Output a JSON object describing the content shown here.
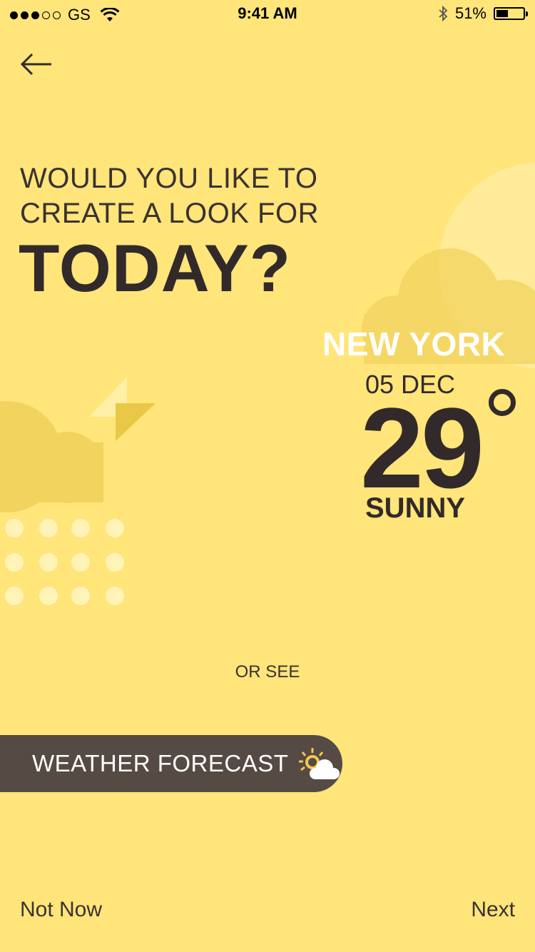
{
  "status_bar": {
    "carrier": "GS",
    "time": "9:41 AM",
    "battery_percent": "51%",
    "battery_level": 0.51,
    "signal_bars_filled": 3,
    "signal_bars_total": 5
  },
  "nav": {
    "back_icon": "arrow-left-icon"
  },
  "question": {
    "line1": "WOULD YOU LIKE TO",
    "line2": "CREATE A LOOK FOR",
    "line3": "TODAY?"
  },
  "weather": {
    "city": "NEW YORK",
    "date": "05 DEC",
    "temperature": "29",
    "condition": "SUNNY"
  },
  "or_see": "OR SEE",
  "forecast_button": {
    "label": "WEATHER FORECAST",
    "icon": "sun-cloud-icon"
  },
  "footer": {
    "not_now": "Not Now",
    "next": "Next"
  },
  "colors": {
    "background": "#FFE57A",
    "text_dark": "#322A2A",
    "button": "#554A44",
    "city_text": "#FFFFFF"
  }
}
